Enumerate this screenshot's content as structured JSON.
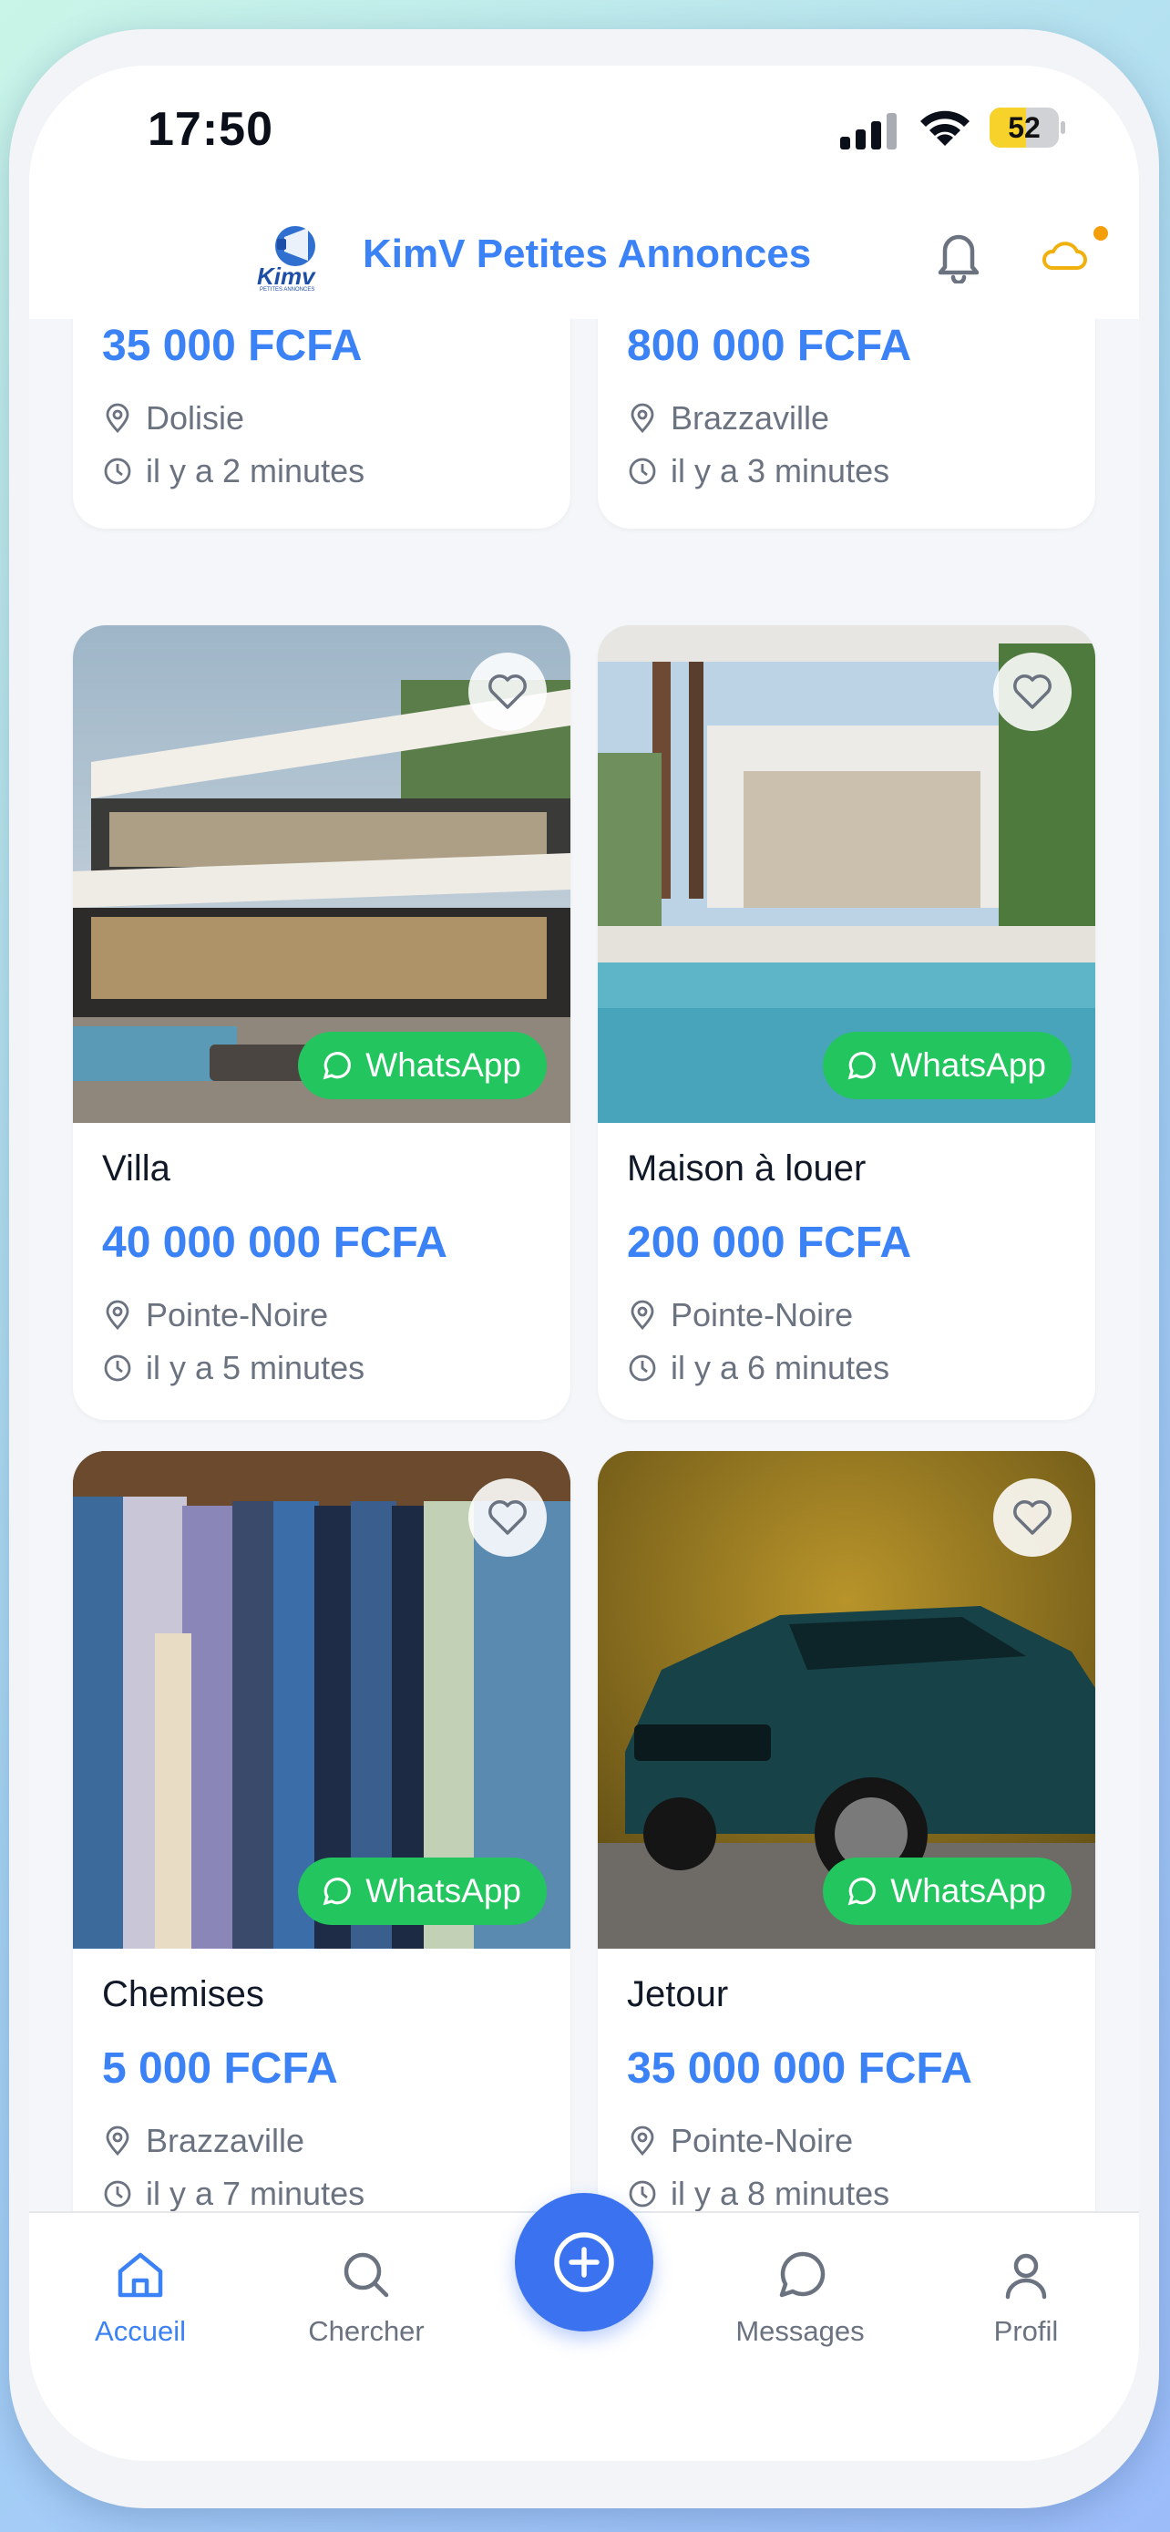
{
  "status_bar": {
    "time": "17:50",
    "battery": "52",
    "battery_level": 0.52
  },
  "header": {
    "app_title": "KimV Petites Annonces",
    "logo_text": "Kimv",
    "logo_subtext": "PETITES ANNONCES"
  },
  "listings": [
    {
      "title": "",
      "price": "35 000 FCFA",
      "location": "Dolisie",
      "time": "il y a 2 minutes"
    },
    {
      "title": "",
      "price": "800 000 FCFA",
      "location": "Brazzaville",
      "time": "il y a 3 minutes"
    },
    {
      "title": "Villa",
      "price": "40 000 000 FCFA",
      "location": "Pointe-Noire",
      "time": "il y a 5 minutes",
      "whatsapp": "WhatsApp"
    },
    {
      "title": "Maison à louer",
      "price": "200 000 FCFA",
      "location": "Pointe-Noire",
      "time": "il y a 6 minutes",
      "whatsapp": "WhatsApp"
    },
    {
      "title": "Chemises",
      "price": "5 000 FCFA",
      "location": "Brazzaville",
      "time": "il y a 7 minutes",
      "whatsapp": "WhatsApp"
    },
    {
      "title": "Jetour",
      "price": "35 000 000 FCFA",
      "location": "Pointe-Noire",
      "time": "il y a 8 minutes",
      "whatsapp": "WhatsApp"
    }
  ],
  "bottom_nav": {
    "home": "Accueil",
    "search": "Chercher",
    "messages": "Messages",
    "profile": "Profil"
  },
  "colors": {
    "accent": "#3b82f6",
    "whatsapp": "#22c55e",
    "notification": "#f59e0b"
  },
  "icons": [
    "bell-icon",
    "cloud-icon",
    "heart-icon",
    "whatsapp-icon",
    "location-pin-icon",
    "clock-icon",
    "home-icon",
    "search-icon",
    "add-icon",
    "chat-icon",
    "user-icon"
  ]
}
